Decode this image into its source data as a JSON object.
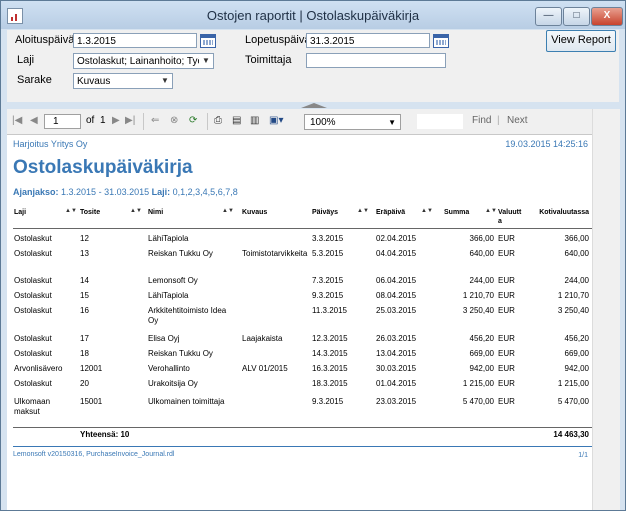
{
  "window": {
    "title": "Ostojen raportit | Ostolaskupäiväkirja",
    "minimize": "—",
    "maximize": "□",
    "close": "X"
  },
  "params": {
    "start_label": "Aloituspäivä",
    "start_value": "1.3.2015",
    "end_label": "Lopetuspäivä",
    "end_value": "31.3.2015",
    "type_label": "Laji",
    "type_value": "Ostolaskut; Lainanhoito; Työna",
    "supplier_label": "Toimittaja",
    "supplier_value": "",
    "column_label": "Sarake",
    "column_value": "Kuvaus",
    "view_report": "View Report"
  },
  "toolbar": {
    "page": "1",
    "of_label": "of",
    "total_pages": "1",
    "zoom": "100%",
    "find": "Find",
    "next": "Next"
  },
  "report": {
    "company": "Harjoitus Yritys Oy",
    "datetime": "19.03.2015 14:25:16",
    "title": "Ostolaskupäiväkirja",
    "period_label": "Ajanjakso:",
    "period_value": "1.3.2015 - 31.03.2015",
    "type_label": "Laji:",
    "type_value": "0,1,2,3,4,5,6,7,8",
    "columns": [
      "Laji",
      "Tosite",
      "Nimi",
      "Kuvaus",
      "Päiväys",
      "Eräpäivä",
      "Summa",
      "Valuutta",
      "Kotivaluutassa"
    ],
    "rows": [
      {
        "laji": "Ostolaskut",
        "tosite": "12",
        "nimi": "LähiTapiola",
        "kuvaus": "",
        "paivays": "3.3.2015",
        "erapaiva": "02.04.2015",
        "summa": "366,00",
        "valuutta": "EUR",
        "koti": "366,00"
      },
      {
        "laji": "Ostolaskut",
        "tosite": "13",
        "nimi": "Reiskan Tukku Oy",
        "kuvaus": "Toimistotarvikkeita",
        "paivays": "5.3.2015",
        "erapaiva": "04.04.2015",
        "summa": "640,00",
        "valuutta": "EUR",
        "koti": "640,00"
      },
      {
        "laji": "Ostolaskut",
        "tosite": "14",
        "nimi": "Lemonsoft Oy",
        "kuvaus": "",
        "paivays": "7.3.2015",
        "erapaiva": "06.04.2015",
        "summa": "244,00",
        "valuutta": "EUR",
        "koti": "244,00"
      },
      {
        "laji": "Ostolaskut",
        "tosite": "15",
        "nimi": "LähiTapiola",
        "kuvaus": "",
        "paivays": "9.3.2015",
        "erapaiva": "08.04.2015",
        "summa": "1 210,70",
        "valuutta": "EUR",
        "koti": "1 210,70"
      },
      {
        "laji": "Ostolaskut",
        "tosite": "16",
        "nimi": "Arkkitehtitoimisto Idea Oy",
        "kuvaus": "",
        "paivays": "11.3.2015",
        "erapaiva": "25.03.2015",
        "summa": "3 250,40",
        "valuutta": "EUR",
        "koti": "3 250,40"
      },
      {
        "laji": "Ostolaskut",
        "tosite": "17",
        "nimi": "Elisa Oyj",
        "kuvaus": "Laajakaista",
        "paivays": "12.3.2015",
        "erapaiva": "26.03.2015",
        "summa": "456,20",
        "valuutta": "EUR",
        "koti": "456,20"
      },
      {
        "laji": "Ostolaskut",
        "tosite": "18",
        "nimi": "Reiskan Tukku Oy",
        "kuvaus": "",
        "paivays": "14.3.2015",
        "erapaiva": "13.04.2015",
        "summa": "669,00",
        "valuutta": "EUR",
        "koti": "669,00"
      },
      {
        "laji": "Arvonlisävero",
        "tosite": "12001",
        "nimi": "Verohallinto",
        "kuvaus": "ALV 01/2015",
        "paivays": "16.3.2015",
        "erapaiva": "30.03.2015",
        "summa": "942,00",
        "valuutta": "EUR",
        "koti": "942,00"
      },
      {
        "laji": "Ostolaskut",
        "tosite": "20",
        "nimi": "Urakoitsija Oy",
        "kuvaus": "",
        "paivays": "18.3.2015",
        "erapaiva": "01.04.2015",
        "summa": "1 215,00",
        "valuutta": "EUR",
        "koti": "1 215,00"
      },
      {
        "laji": "Ulkomaan maksut",
        "tosite": "15001",
        "nimi": "Ulkomainen toimittaja",
        "kuvaus": "",
        "paivays": "9.3.2015",
        "erapaiva": "23.03.2015",
        "summa": "5 470,00",
        "valuutta": "EUR",
        "koti": "5 470,00"
      }
    ],
    "total_label": "Yhteensä: 10",
    "total_value": "14 463,30",
    "footer_left": "Lemonsoft v20150316, PurchaseInvoice_Journal.rdl",
    "footer_right": "1/1"
  }
}
